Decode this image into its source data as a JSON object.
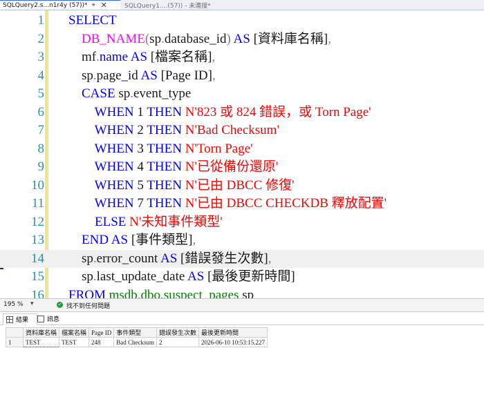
{
  "tabs": [
    {
      "label": "SQLQuery2.s...n1r4y (57))*",
      "pin": "⌖",
      "close": "✕"
    },
    {
      "label": "SQLQuery1....(57)) - 未連接*"
    }
  ],
  "editor": {
    "lines": [
      {
        "num": "1",
        "tokens": [
          {
            "t": "    ",
            "c": "id"
          },
          {
            "t": "SELECT",
            "c": "kw"
          }
        ]
      },
      {
        "num": "2",
        "tokens": [
          {
            "t": "        ",
            "c": "id"
          },
          {
            "t": "DB_NAME",
            "c": "fn"
          },
          {
            "t": "(",
            "c": "op"
          },
          {
            "t": "sp",
            "c": "id"
          },
          {
            "t": ".",
            "c": "op"
          },
          {
            "t": "database_id",
            "c": "id"
          },
          {
            "t": ")",
            "c": "op"
          },
          {
            "t": " ",
            "c": "id"
          },
          {
            "t": "AS",
            "c": "kw"
          },
          {
            "t": " [資料庫名稱]",
            "c": "id"
          },
          {
            "t": ",",
            "c": "op"
          }
        ]
      },
      {
        "num": "3",
        "tokens": [
          {
            "t": "        mf",
            "c": "id"
          },
          {
            "t": ".",
            "c": "op"
          },
          {
            "t": "name",
            "c": "kw"
          },
          {
            "t": " ",
            "c": "id"
          },
          {
            "t": "AS",
            "c": "kw"
          },
          {
            "t": " [檔案名稱]",
            "c": "id"
          },
          {
            "t": ",",
            "c": "op"
          }
        ]
      },
      {
        "num": "4",
        "tokens": [
          {
            "t": "        sp",
            "c": "id"
          },
          {
            "t": ".",
            "c": "op"
          },
          {
            "t": "page_id",
            "c": "id"
          },
          {
            "t": " ",
            "c": "id"
          },
          {
            "t": "AS",
            "c": "kw"
          },
          {
            "t": " [Page ID]",
            "c": "id"
          },
          {
            "t": ",",
            "c": "op"
          }
        ]
      },
      {
        "num": "5",
        "tokens": [
          {
            "t": "        ",
            "c": "id"
          },
          {
            "t": "CASE",
            "c": "kw"
          },
          {
            "t": " sp",
            "c": "id"
          },
          {
            "t": ".",
            "c": "op"
          },
          {
            "t": "event_type",
            "c": "id"
          }
        ]
      },
      {
        "num": "6",
        "tokens": [
          {
            "t": "            ",
            "c": "id"
          },
          {
            "t": "WHEN",
            "c": "kw"
          },
          {
            "t": " 1 ",
            "c": "id"
          },
          {
            "t": "THEN",
            "c": "kw"
          },
          {
            "t": " N'823 或 824 錯誤，或 Torn Page'",
            "c": "str"
          }
        ]
      },
      {
        "num": "7",
        "tokens": [
          {
            "t": "            ",
            "c": "id"
          },
          {
            "t": "WHEN",
            "c": "kw"
          },
          {
            "t": " 2 ",
            "c": "id"
          },
          {
            "t": "THEN",
            "c": "kw"
          },
          {
            "t": " N'Bad Checksum'",
            "c": "str"
          }
        ]
      },
      {
        "num": "8",
        "tokens": [
          {
            "t": "            ",
            "c": "id"
          },
          {
            "t": "WHEN",
            "c": "kw"
          },
          {
            "t": " 3 ",
            "c": "id"
          },
          {
            "t": "THEN",
            "c": "kw"
          },
          {
            "t": " N'Torn Page'",
            "c": "str"
          }
        ]
      },
      {
        "num": "9",
        "tokens": [
          {
            "t": "            ",
            "c": "id"
          },
          {
            "t": "WHEN",
            "c": "kw"
          },
          {
            "t": " 4 ",
            "c": "id"
          },
          {
            "t": "THEN",
            "c": "kw"
          },
          {
            "t": " N'已從備份還原'",
            "c": "str"
          }
        ]
      },
      {
        "num": "10",
        "tokens": [
          {
            "t": "            ",
            "c": "id"
          },
          {
            "t": "WHEN",
            "c": "kw"
          },
          {
            "t": " 5 ",
            "c": "id"
          },
          {
            "t": "THEN",
            "c": "kw"
          },
          {
            "t": " N'已由 DBCC 修復'",
            "c": "str"
          }
        ]
      },
      {
        "num": "11",
        "tokens": [
          {
            "t": "            ",
            "c": "id"
          },
          {
            "t": "WHEN",
            "c": "kw"
          },
          {
            "t": " 7 ",
            "c": "id"
          },
          {
            "t": "THEN",
            "c": "kw"
          },
          {
            "t": " N'已由 DBCC CHECKDB 釋放配置'",
            "c": "str"
          }
        ]
      },
      {
        "num": "12",
        "tokens": [
          {
            "t": "            ",
            "c": "id"
          },
          {
            "t": "ELSE",
            "c": "kw"
          },
          {
            "t": " N'未知事件類型'",
            "c": "str"
          }
        ]
      },
      {
        "num": "13",
        "tokens": [
          {
            "t": "        ",
            "c": "id"
          },
          {
            "t": "END",
            "c": "kw"
          },
          {
            "t": " ",
            "c": "id"
          },
          {
            "t": "AS",
            "c": "kw"
          },
          {
            "t": " [事件類型]",
            "c": "id"
          },
          {
            "t": ",",
            "c": "op"
          }
        ]
      },
      {
        "num": "14",
        "tokens": [
          {
            "t": "        sp",
            "c": "id"
          },
          {
            "t": ".",
            "c": "op"
          },
          {
            "t": "error_count",
            "c": "id"
          },
          {
            "t": " ",
            "c": "id"
          },
          {
            "t": "AS",
            "c": "kw"
          },
          {
            "t": " [錯誤發生次數]",
            "c": "id"
          },
          {
            "t": ",",
            "c": "op"
          }
        ]
      },
      {
        "num": "15",
        "tokens": [
          {
            "t": "        sp",
            "c": "id"
          },
          {
            "t": ".",
            "c": "op"
          },
          {
            "t": "last_update_date",
            "c": "id"
          },
          {
            "t": " ",
            "c": "id"
          },
          {
            "t": "AS",
            "c": "kw"
          },
          {
            "t": " [最後更新時間]",
            "c": "id"
          }
        ]
      },
      {
        "num": "16",
        "tokens": [
          {
            "t": "    ",
            "c": "id"
          },
          {
            "t": "FROM",
            "c": "kw"
          },
          {
            "t": " ",
            "c": "id"
          },
          {
            "t": "msdb",
            "c": "sys"
          },
          {
            "t": ".",
            "c": "op"
          },
          {
            "t": "dbo",
            "c": "sys"
          },
          {
            "t": ".",
            "c": "op"
          },
          {
            "t": "suspect_pages",
            "c": "sys"
          },
          {
            "t": " sp",
            "c": "id"
          }
        ]
      }
    ]
  },
  "status": {
    "zoom": "195 %",
    "zoom_caret": "▾",
    "ok_glyph": "✓",
    "issues": "找不到任何問題"
  },
  "result_tabs": {
    "results": "結果",
    "messages": "訊息"
  },
  "grid": {
    "columns": [
      "資料庫名稱",
      "檔案名稱",
      "Page ID",
      "事件類型",
      "錯誤發生次數",
      "最後更新時間"
    ],
    "rows": [
      {
        "num": "1",
        "cells": [
          "TEST",
          "TEST",
          "248",
          "Bad Checksum",
          "2",
          "2026-06-10 10:53:15.227"
        ]
      }
    ]
  }
}
